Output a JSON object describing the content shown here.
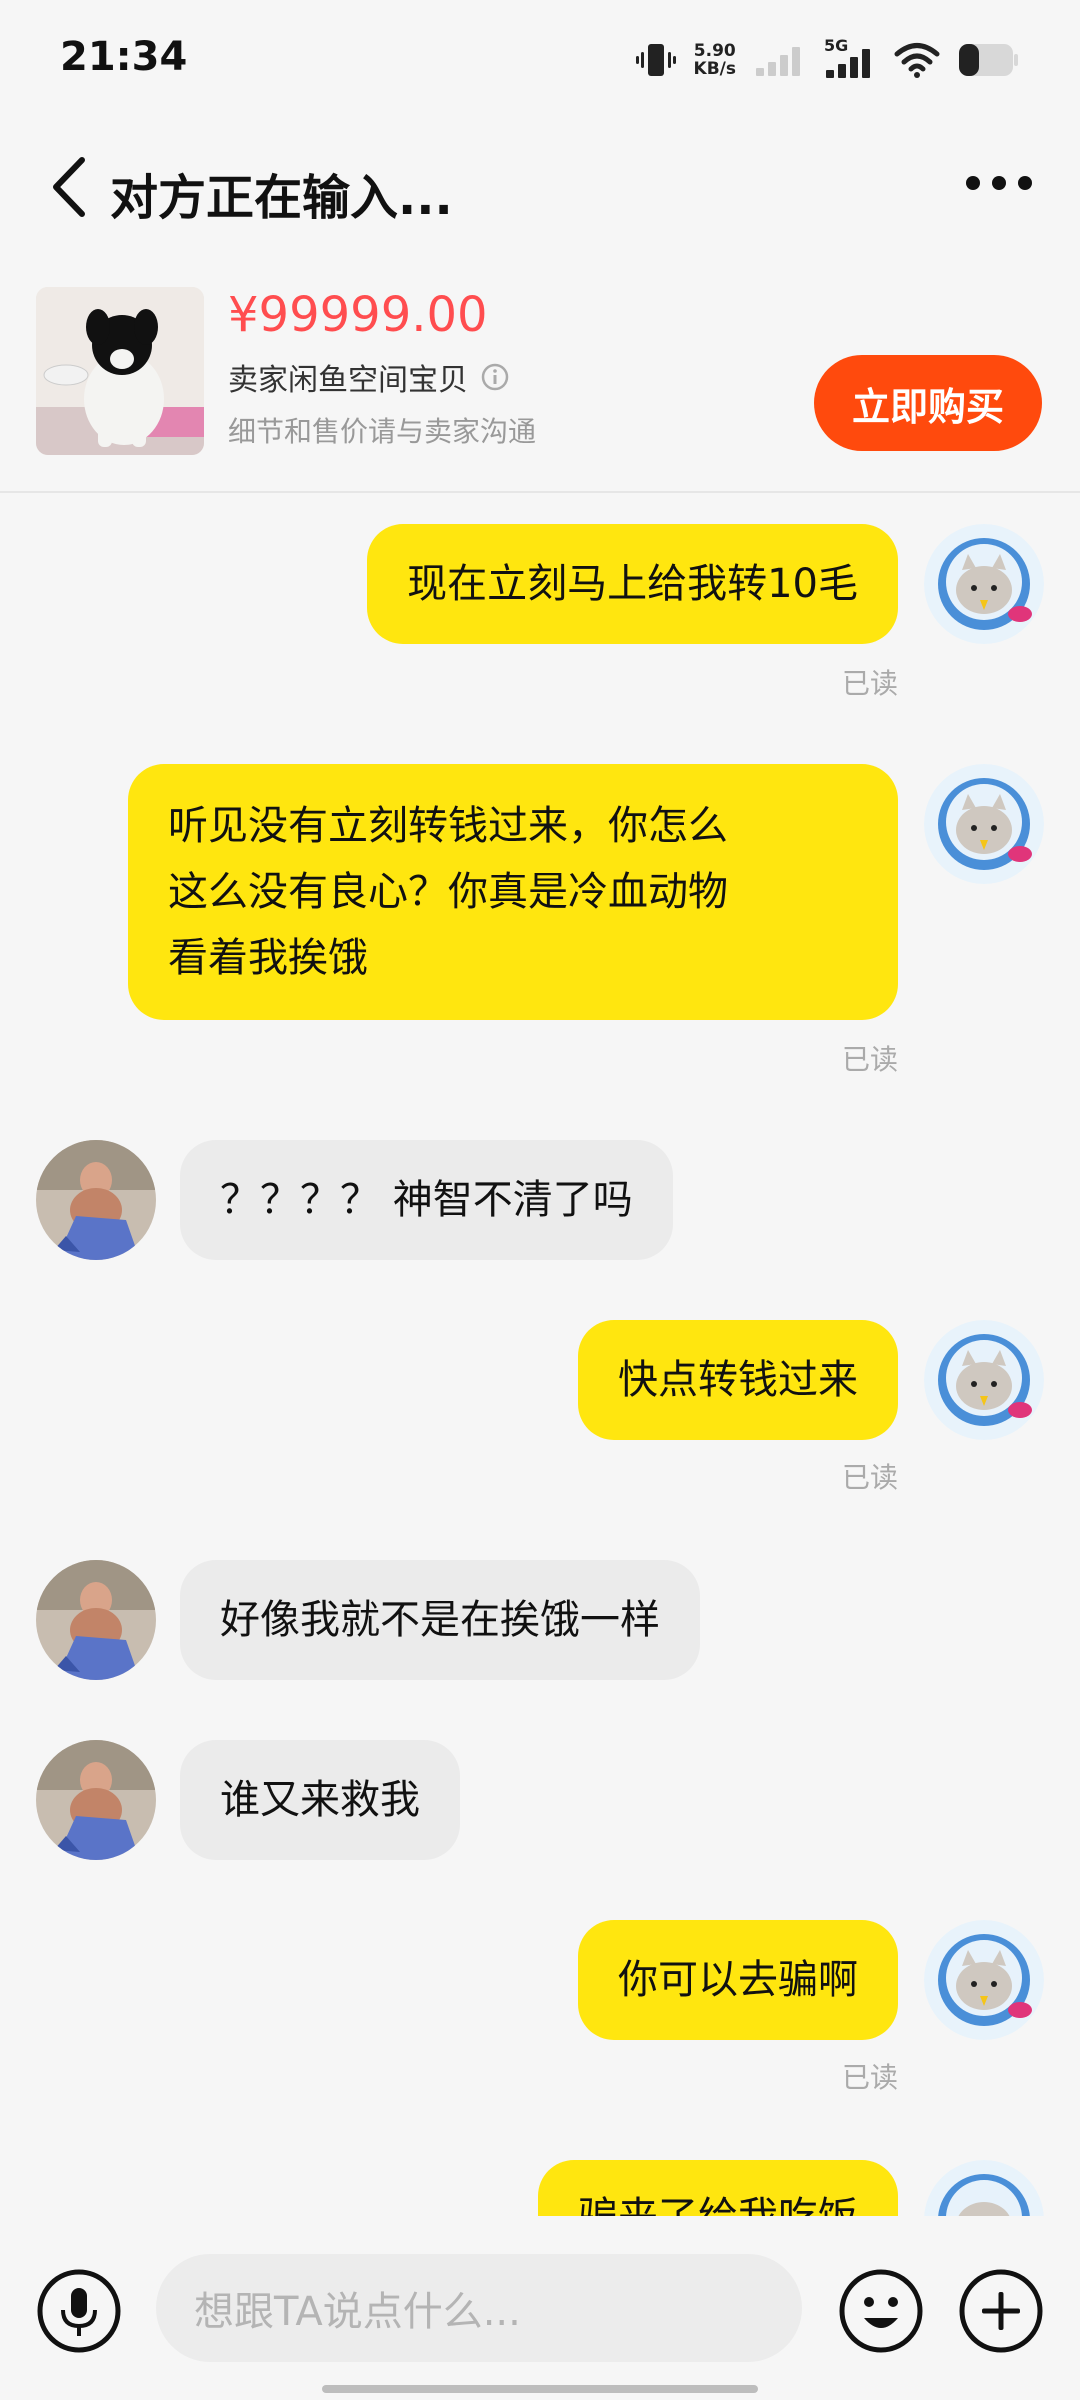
{
  "status_bar": {
    "time": "21:34",
    "net_speed_value": "5.90",
    "net_speed_unit": "KB/s",
    "network": "5G",
    "icons": [
      "vibrate-icon",
      "signal-weak-icon",
      "signal-5g-icon",
      "wifi-icon",
      "battery-icon"
    ]
  },
  "header": {
    "title": "对方正在输入...",
    "back_icon": "chevron-left-icon",
    "more_icon": "more-dots-icon"
  },
  "product": {
    "price": "¥99999.00",
    "title": "卖家闲鱼空间宝贝",
    "subtitle": "细节和售价请与卖家沟通",
    "buy_label": "立即购买",
    "accent_color": "#ff4a0d",
    "price_color": "#ff4d4f"
  },
  "messages": [
    {
      "from": "me",
      "text": "现在立刻马上给我转10毛",
      "status": "已读"
    },
    {
      "from": "me",
      "lines": [
        "听见没有立刻转钱过来，你怎么",
        "这么没有良心？你真是冷血动物",
        "看着我挨饿"
      ],
      "status": "已读"
    },
    {
      "from": "other",
      "text": "？？？？ 神智不清了吗"
    },
    {
      "from": "me",
      "text": "快点转钱过来",
      "status": "已读"
    },
    {
      "from": "other",
      "text": "好像我就不是在挨饿一样"
    },
    {
      "from": "other",
      "text": "谁又来救我"
    },
    {
      "from": "me",
      "text": "你可以去骗啊",
      "status": "已读"
    },
    {
      "from": "me",
      "text": "骗来了给我吃饭"
    }
  ],
  "input": {
    "placeholder": "想跟TA说点什么..."
  },
  "colors": {
    "my_bubble": "#ffe60f",
    "other_bubble": "#ebebeb",
    "background": "#f6f6f6"
  }
}
